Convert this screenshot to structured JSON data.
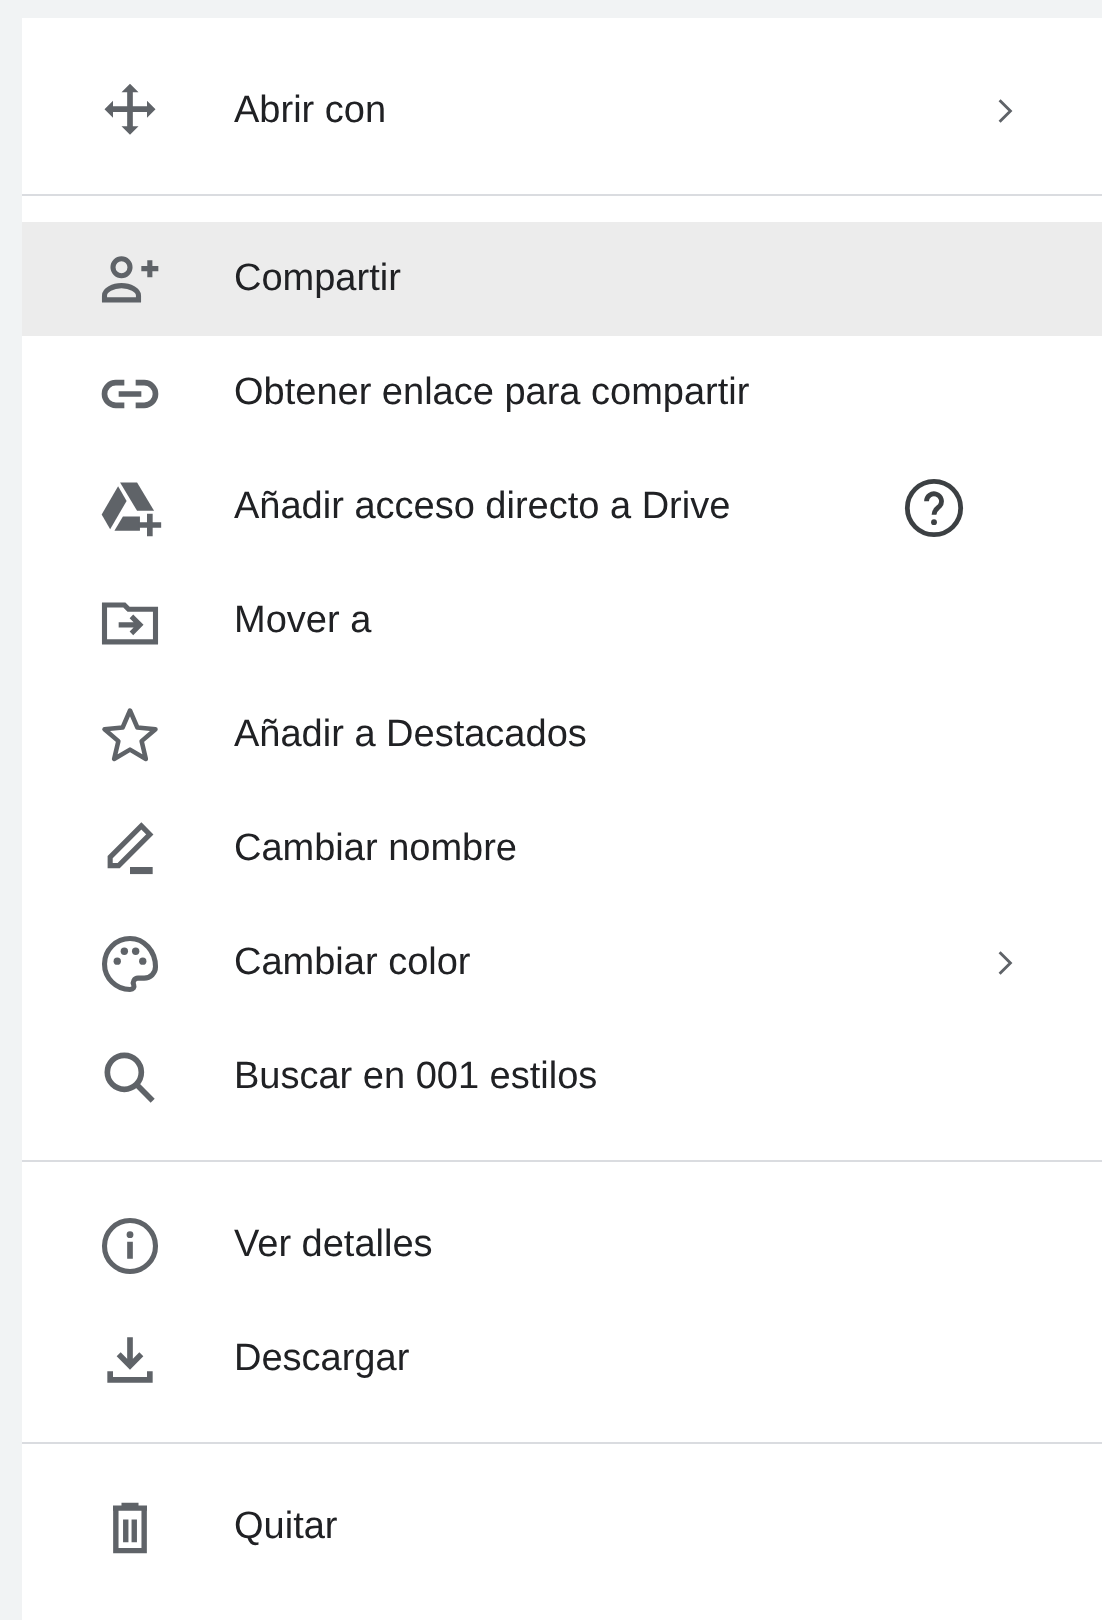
{
  "menu": {
    "sections": [
      {
        "items": [
          {
            "label": "Abrir con",
            "selected": false,
            "submenu": true,
            "help": false
          }
        ]
      },
      {
        "items": [
          {
            "label": "Compartir",
            "selected": true,
            "submenu": false,
            "help": false
          },
          {
            "label": "Obtener enlace para compartir",
            "selected": false,
            "submenu": false,
            "help": false
          },
          {
            "label": "Añadir acceso directo a Drive",
            "selected": false,
            "submenu": false,
            "help": true
          },
          {
            "label": "Mover a",
            "selected": false,
            "submenu": false,
            "help": false
          },
          {
            "label": "Añadir a Destacados",
            "selected": false,
            "submenu": false,
            "help": false
          },
          {
            "label": "Cambiar nombre",
            "selected": false,
            "submenu": false,
            "help": false
          },
          {
            "label": "Cambiar color",
            "selected": false,
            "submenu": true,
            "help": false
          },
          {
            "label": "Buscar en 001 estilos",
            "selected": false,
            "submenu": false,
            "help": false
          }
        ]
      },
      {
        "items": [
          {
            "label": "Ver detalles",
            "selected": false,
            "submenu": false,
            "help": false
          },
          {
            "label": "Descargar",
            "selected": false,
            "submenu": false,
            "help": false
          }
        ]
      },
      {
        "items": [
          {
            "label": "Quitar",
            "selected": false,
            "submenu": false,
            "help": false
          }
        ]
      }
    ]
  }
}
